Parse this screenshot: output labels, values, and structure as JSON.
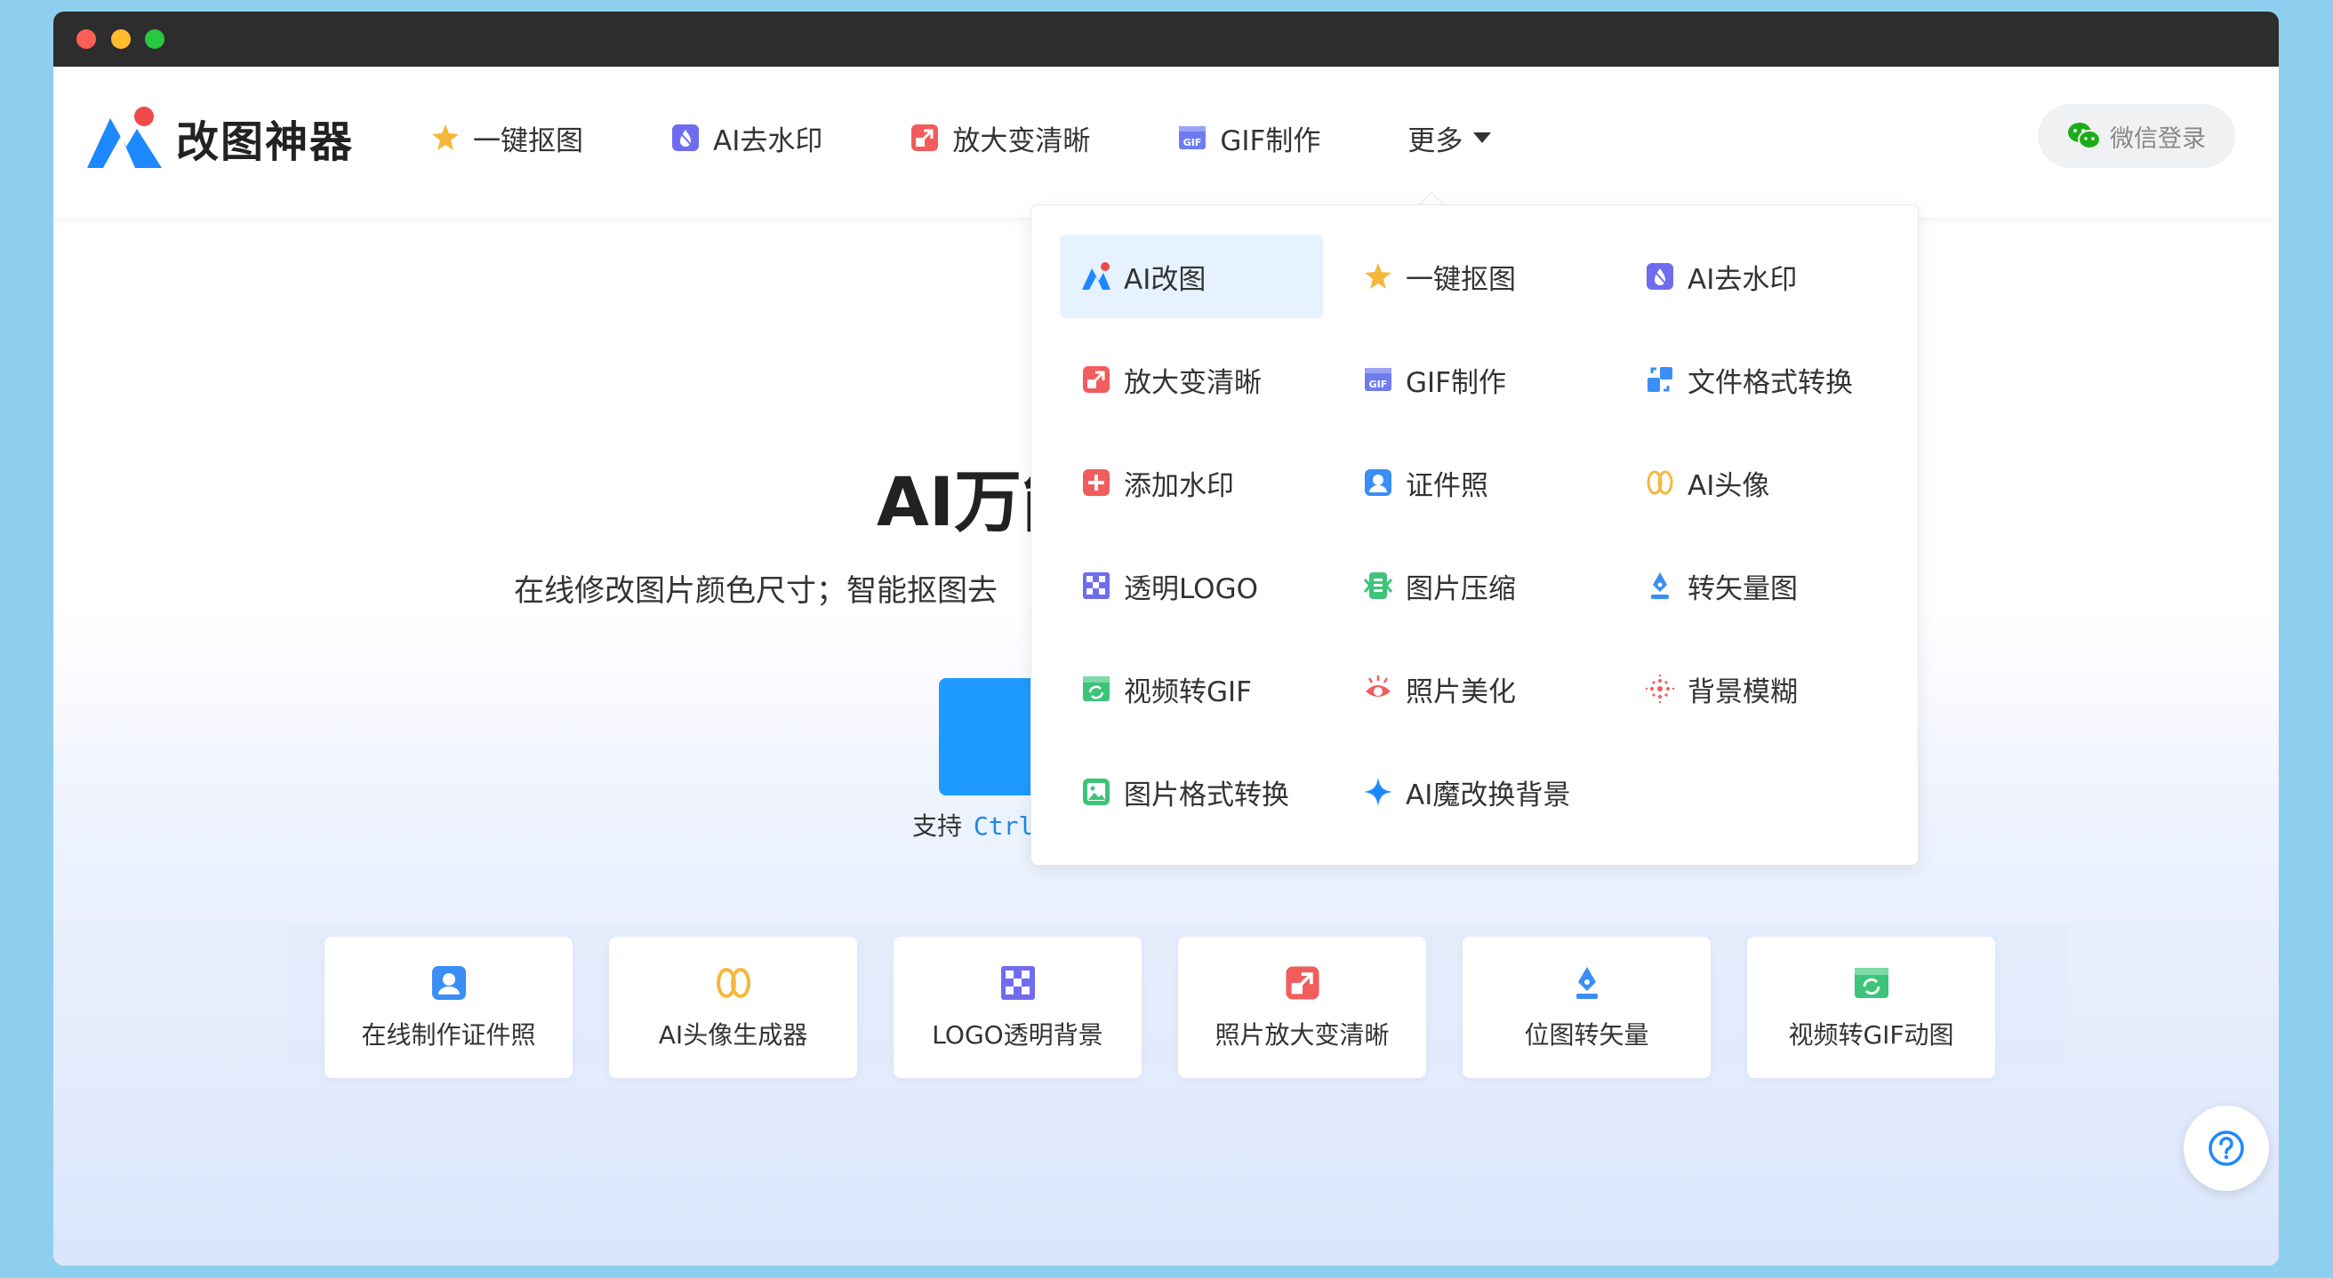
{
  "brand": {
    "name": "改图神器"
  },
  "nav": {
    "items": [
      {
        "label": "一键抠图",
        "icon": "star-icon",
        "color": "#f5b83b"
      },
      {
        "label": "AI去水印",
        "icon": "watermark-remove-icon",
        "color": "#6f6cf0"
      },
      {
        "label": "放大变清晰",
        "icon": "enlarge-icon",
        "color": "#f25c5c"
      },
      {
        "label": "GIF制作",
        "icon": "gif-icon",
        "color": "#6f7cf0"
      }
    ],
    "more_label": "更多"
  },
  "login": {
    "label": "微信登录"
  },
  "hero": {
    "title": "AI万能",
    "subtitle": "在线修改图片颜色尺寸；智能抠图去",
    "hint_prefix": "支持 ",
    "hint_key": "Ctrl"
  },
  "dropdown": {
    "items": [
      {
        "label": "AI改图",
        "icon": "ai-logo-icon",
        "active": true
      },
      {
        "label": "一键抠图",
        "icon": "star-icon"
      },
      {
        "label": "AI去水印",
        "icon": "watermark-remove-icon"
      },
      {
        "label": "放大变清晰",
        "icon": "enlarge-icon"
      },
      {
        "label": "GIF制作",
        "icon": "gif-icon"
      },
      {
        "label": "文件格式转换",
        "icon": "format-convert-icon"
      },
      {
        "label": "添加水印",
        "icon": "add-watermark-icon"
      },
      {
        "label": "证件照",
        "icon": "id-photo-icon"
      },
      {
        "label": "AI头像",
        "icon": "ai-avatar-icon"
      },
      {
        "label": "透明LOGO",
        "icon": "transparent-logo-icon"
      },
      {
        "label": "图片压缩",
        "icon": "compress-icon"
      },
      {
        "label": "转矢量图",
        "icon": "vector-pen-icon"
      },
      {
        "label": "视频转GIF",
        "icon": "video-gif-icon"
      },
      {
        "label": "照片美化",
        "icon": "beautify-eye-icon"
      },
      {
        "label": "背景模糊",
        "icon": "blur-background-icon"
      },
      {
        "label": "图片格式转换",
        "icon": "image-format-icon"
      },
      {
        "label": "AI魔改换背景",
        "icon": "sparkle-icon"
      }
    ]
  },
  "cards": [
    {
      "label": "在线制作证件照",
      "icon": "id-photo-icon"
    },
    {
      "label": "AI头像生成器",
      "icon": "ai-avatar-icon"
    },
    {
      "label": "LOGO透明背景",
      "icon": "transparent-logo-icon"
    },
    {
      "label": "照片放大变清晰",
      "icon": "enlarge-icon"
    },
    {
      "label": "位图转矢量",
      "icon": "vector-pen-icon"
    },
    {
      "label": "视频转GIF动图",
      "icon": "video-gif-icon"
    }
  ],
  "colors": {
    "accent": "#1f9bff",
    "brand_blue": "#1e88ff",
    "brand_red": "#f04a4a"
  }
}
